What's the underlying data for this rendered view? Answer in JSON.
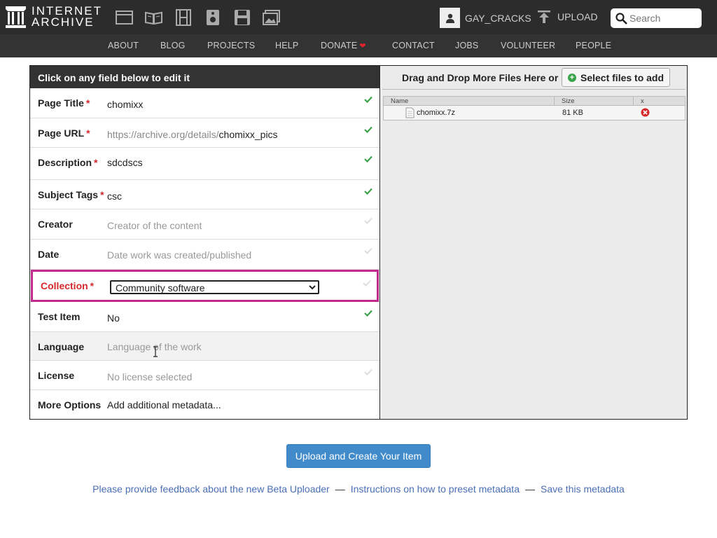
{
  "header": {
    "logo_line1": "INTERNET",
    "logo_line2": "ARCHIVE",
    "media_icons": [
      "web-icon",
      "texts-icon",
      "video-icon",
      "audio-icon",
      "software-icon",
      "images-icon"
    ],
    "username": "GAY_CRACKS",
    "upload_label": "UPLOAD",
    "search_placeholder": "Search"
  },
  "nav": {
    "items": [
      "ABOUT",
      "BLOG",
      "PROJECTS",
      "HELP",
      "DONATE",
      "CONTACT",
      "JOBS",
      "VOLUNTEER",
      "PEOPLE"
    ]
  },
  "form": {
    "header": "Click on any field below to edit it",
    "fields": {
      "page_title": {
        "label": "Page Title",
        "value": "chomixx"
      },
      "page_url": {
        "label": "Page URL",
        "prefix": "https://archive.org/details/",
        "value": "chomixx_pics"
      },
      "description": {
        "label": "Description",
        "value": "sdcdscs"
      },
      "subject_tags": {
        "label": "Subject Tags",
        "value": "csc"
      },
      "creator": {
        "label": "Creator",
        "placeholder": "Creator of the content"
      },
      "date": {
        "label": "Date",
        "placeholder": "Date work was created/published"
      },
      "collection": {
        "label": "Collection",
        "value": "Community software"
      },
      "test_item": {
        "label": "Test Item",
        "value": "No"
      },
      "language": {
        "label": "Language",
        "placeholder": "Language of the work"
      },
      "license": {
        "label": "License",
        "placeholder": "No license selected"
      },
      "more_options": {
        "label": "More Options",
        "link": "Add additional metadata..."
      }
    },
    "required_mark": "*"
  },
  "files": {
    "drop_text": "Drag and Drop More Files Here or",
    "select_button": "Select files to add",
    "columns": [
      "Name",
      "Size",
      "x"
    ],
    "rows": [
      {
        "name": "chomixx.7z",
        "size": "81 KB"
      }
    ]
  },
  "actions": {
    "upload_button": "Upload and Create Your Item"
  },
  "footer": {
    "feedback": "Please provide feedback about the new Beta Uploader",
    "instructions": "Instructions on how to preset metadata",
    "save": "Save this metadata",
    "separator": "—"
  },
  "colors": {
    "topbar": "#2c2c2c",
    "accent_required": "#d6282b",
    "collection_highlight": "#c12a8d",
    "link": "#4a6fb5",
    "primary_button": "#428bca",
    "checkmark": "#3ba34a"
  }
}
